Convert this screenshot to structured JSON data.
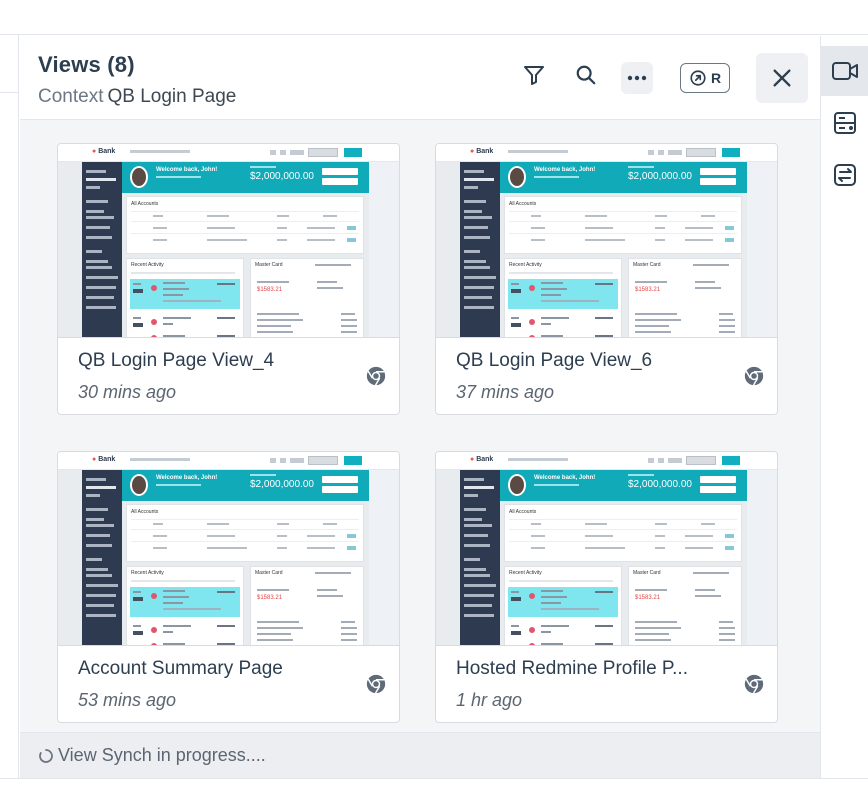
{
  "panel": {
    "title": "Views (8)",
    "context_label": "Context",
    "context_value": "QB Login Page"
  },
  "toolbar": {
    "filter_icon": "filter-icon",
    "search_icon": "search-icon",
    "more_icon": "more-horizontal-icon",
    "r_button_label": "R",
    "close_icon": "close-icon"
  },
  "right_sidebar": {
    "items": [
      {
        "icon": "video-camera-icon",
        "active": true
      },
      {
        "icon": "device-storage-icon",
        "active": false
      },
      {
        "icon": "swap-icon",
        "active": false
      }
    ]
  },
  "views": [
    {
      "name": "QB Login Page View_4",
      "time": "30 mins ago",
      "browser": "chrome-icon"
    },
    {
      "name": "QB Login Page View_6",
      "time": "37 mins ago",
      "browser": "chrome-icon"
    },
    {
      "name": "Account Summary Page",
      "time": "53 mins ago",
      "browser": "chrome-icon"
    },
    {
      "name": "Hosted Redmine Profile P...",
      "time": "1 hr ago",
      "browser": "chrome-icon"
    }
  ],
  "thumbnail": {
    "logo": "Bank",
    "welcome": "Welcome back, John!",
    "balance": "$2,000,000.00",
    "accounts_heading": "All Accounts",
    "recent_heading": "Recent Activity",
    "card_heading": "Master Card",
    "card_balance": "$1583.21"
  },
  "footer": {
    "sync_text": "View Synch in progress...."
  },
  "colors": {
    "accent_teal": "#10aab8",
    "sidebar_dark": "#2d3a4f",
    "panel_bg": "#f4f5f7"
  }
}
